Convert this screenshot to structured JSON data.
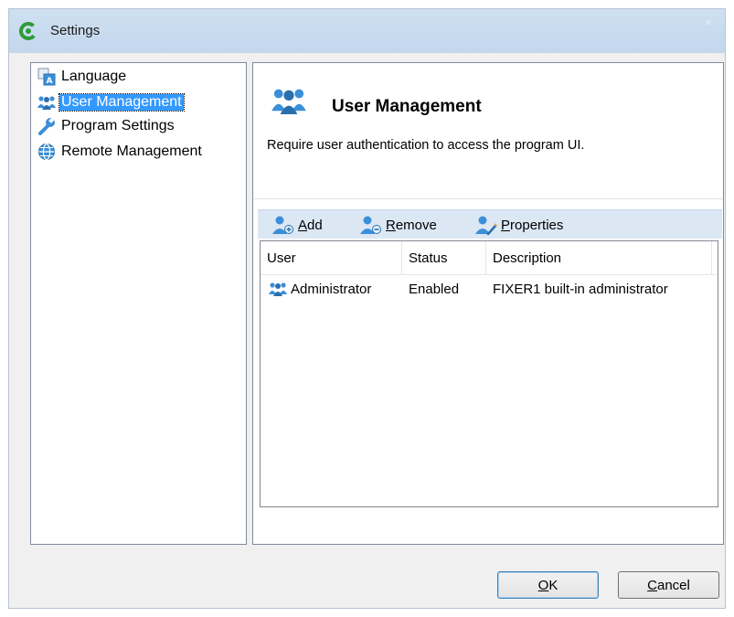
{
  "window": {
    "title": "Settings",
    "app_icon": "app-c-logo-icon",
    "close_glyph": "×"
  },
  "sidebar": {
    "items": [
      {
        "label": "Language",
        "icon": "language-icon"
      },
      {
        "label": "User Management",
        "icon": "users-icon",
        "selected": true
      },
      {
        "label": "Program Settings",
        "icon": "wrench-icon"
      },
      {
        "label": "Remote Management",
        "icon": "globe-icon"
      }
    ]
  },
  "panel": {
    "title": "User Management",
    "description": "Require user authentication to access the program UI."
  },
  "toolbar": {
    "add": {
      "accel": "A",
      "rest": "dd"
    },
    "remove": {
      "accel": "R",
      "rest": "emove"
    },
    "properties": {
      "accel": "P",
      "rest": "roperties"
    }
  },
  "table": {
    "columns": [
      "User",
      "Status",
      "Description"
    ],
    "rows": [
      {
        "user": "Administrator",
        "status": "Enabled",
        "description": "FIXER1 built-in administrator"
      }
    ]
  },
  "buttons": {
    "ok": {
      "accel": "O",
      "rest": "K"
    },
    "cancel": {
      "accel": "C",
      "rest": "ancel"
    }
  },
  "colors": {
    "selection": "#3399ff",
    "toolbar_bg": "#dce7f4",
    "users_icon": "#3a8fd8",
    "app_logo": "#2e9a3a"
  }
}
